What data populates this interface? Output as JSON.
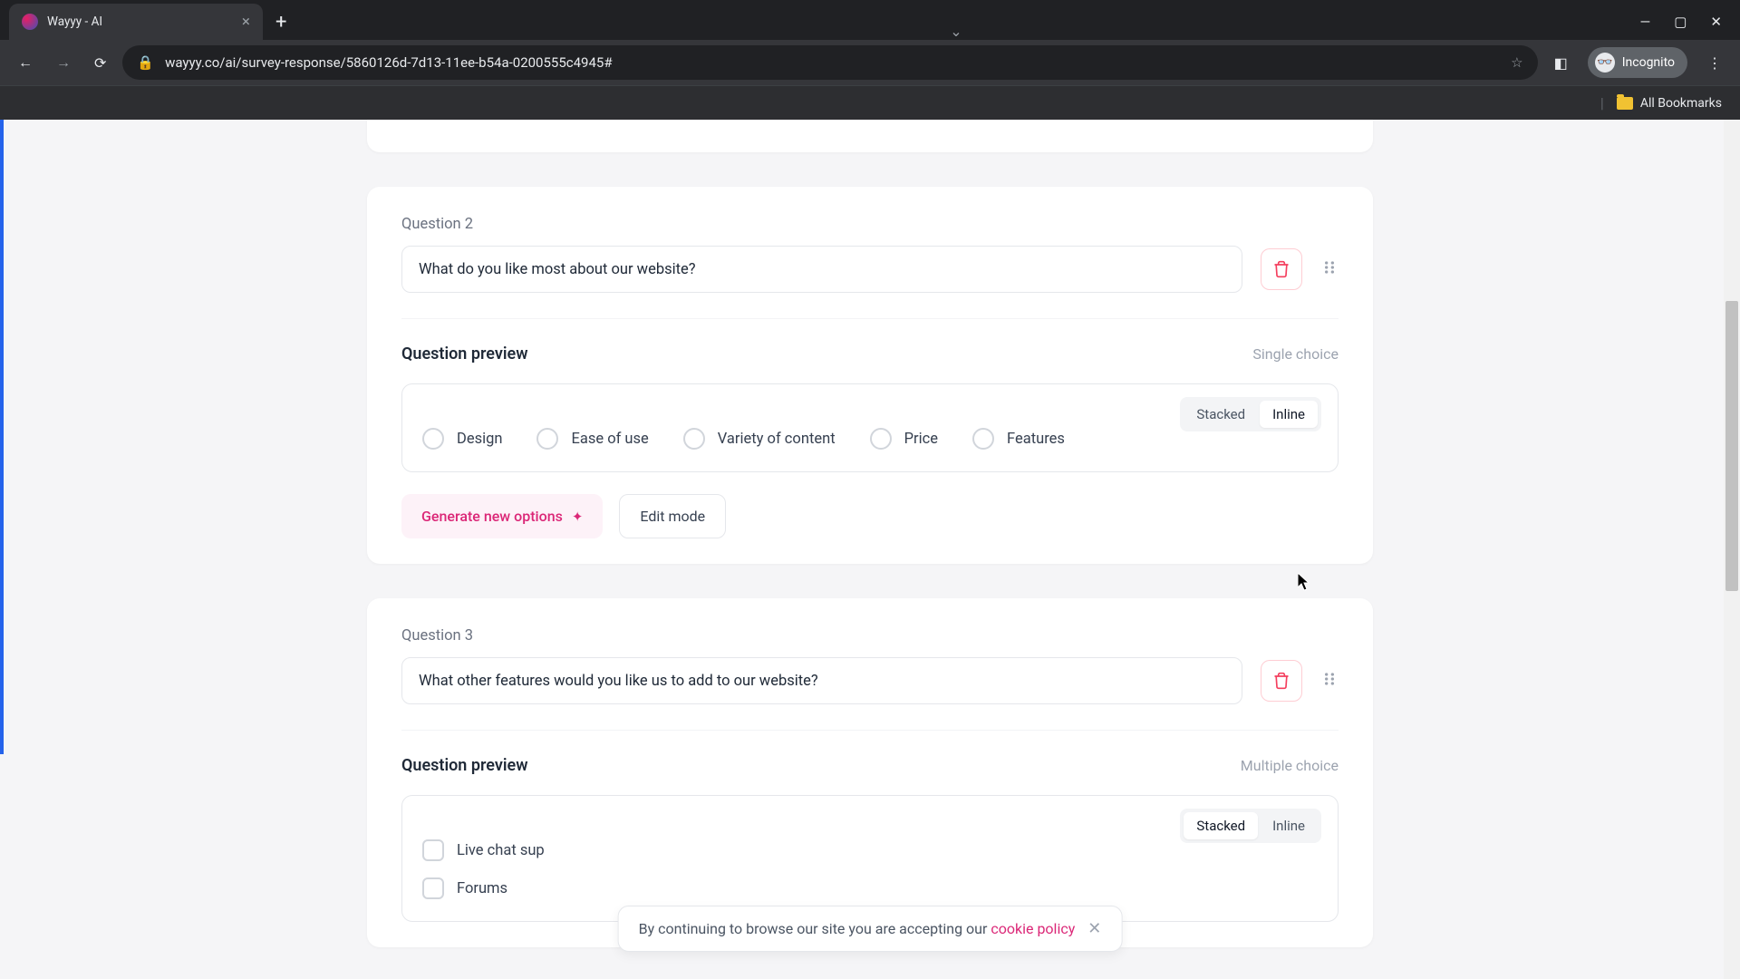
{
  "browser": {
    "tab_title": "Wayyy - AI",
    "url": "wayyy.co/ai/survey-response/5860126d-7d13-11ee-b54a-0200555c4945#",
    "incognito_label": "Incognito",
    "bookmarks_label": "All Bookmarks"
  },
  "q2": {
    "label": "Question 2",
    "text": "What do you like most about our website?",
    "preview_title": "Question preview",
    "type": "Single choice",
    "toggle": {
      "stacked": "Stacked",
      "inline": "Inline"
    },
    "options": [
      "Design",
      "Ease of use",
      "Variety of content",
      "Price",
      "Features"
    ],
    "generate": "Generate new options",
    "edit": "Edit mode"
  },
  "q3": {
    "label": "Question 3",
    "text": "What other features would you like us to add to our website?",
    "preview_title": "Question preview",
    "type": "Multiple choice",
    "toggle": {
      "stacked": "Stacked",
      "inline": "Inline"
    },
    "options": [
      "Live chat sup",
      "Forums"
    ]
  },
  "cookie": {
    "text": "By continuing to browse our site you are accepting our ",
    "link": "cookie policy"
  }
}
